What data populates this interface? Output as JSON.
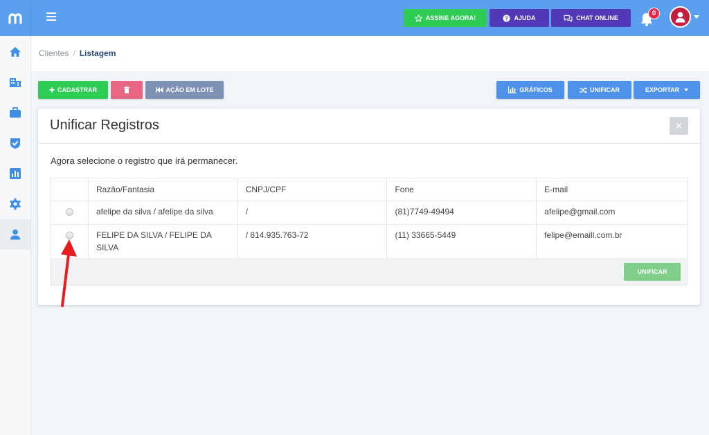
{
  "topbar": {
    "subscribe_label": "ASSINE AGORA!",
    "help_label": "AJUDA",
    "chat_label": "CHAT ONLINE",
    "notifications_count": "0"
  },
  "breadcrumb": {
    "parent": "Clientes",
    "separator": "/",
    "current": "Listagem"
  },
  "toolbar": {
    "register_label": "CADASTRAR",
    "batch_label": "AÇÃO EM LOTE",
    "charts_label": "GRÁFICOS",
    "merge_label": "UNIFICAR",
    "export_label": "EXPORTAR"
  },
  "modal": {
    "title": "Unificar Registros",
    "close_symbol": "×",
    "instruction": "Agora selecione o registro que irá permanecer.",
    "columns": [
      "",
      "Razão/Fantasia",
      "CNPJ/CPF",
      "Fone",
      "E-mail"
    ],
    "rows": [
      {
        "name": "afelipe da silva / afelipe da silva",
        "doc": "/",
        "phone": "(81)7749-49494",
        "email": "afelipe@gmail.com"
      },
      {
        "name": "FELIPE DA SILVA / FELIPE DA SILVA",
        "doc": "/ 814.935.763-72",
        "phone": "(11) 33665-5449",
        "email": "felipe@emaill.com.br"
      }
    ],
    "submit_label": "UNIFICAR"
  },
  "colors": {
    "primary": "#5aa0ee",
    "green": "#2ecc55",
    "purple": "#5038b6",
    "danger": "#e66684",
    "muted_blue": "#7d91b5",
    "button_blue": "#4e92ec",
    "annotation_arrow": "#e81c1c"
  },
  "icons": {
    "sidebar": [
      "home-icon",
      "building-icon",
      "briefcase-icon",
      "check-shield-icon",
      "bar-chart-icon",
      "gear-icon",
      "user-icon"
    ]
  }
}
